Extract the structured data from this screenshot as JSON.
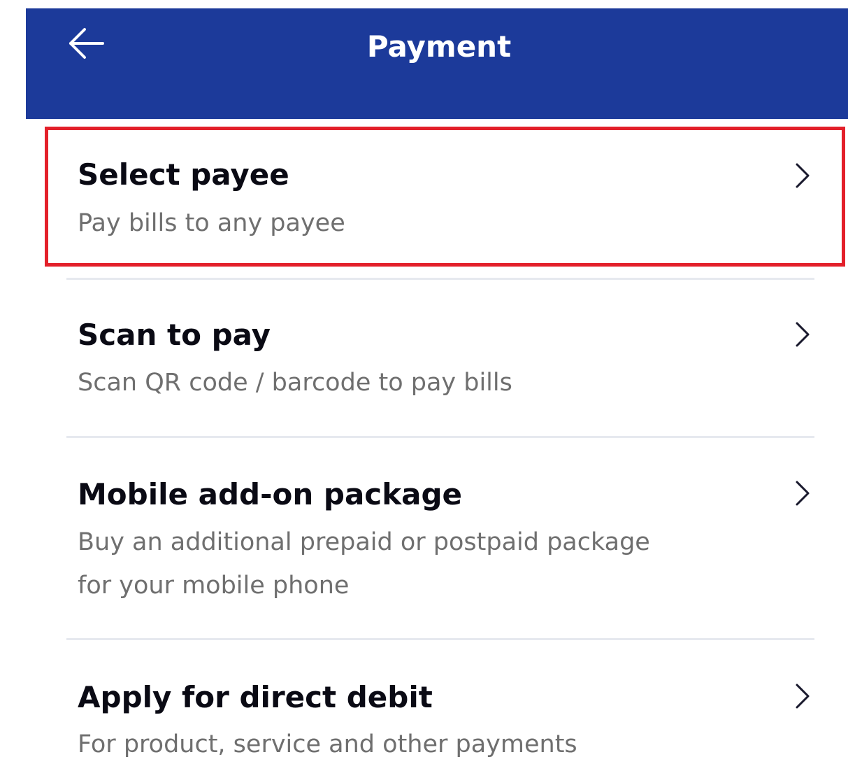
{
  "header": {
    "title": "Payment",
    "back_icon": "arrow-left-icon",
    "background_color": "#1c3a9a"
  },
  "menu": {
    "items": [
      {
        "title": "Select payee",
        "description": "Pay bills to any payee",
        "icon": "chevron-right-icon",
        "highlighted": true
      },
      {
        "title": "Scan to pay",
        "description": "Scan QR code / barcode to pay bills",
        "icon": "chevron-right-icon"
      },
      {
        "title": "Mobile add-on package",
        "description": "Buy an additional prepaid or postpaid package\nfor your mobile phone",
        "icon": "chevron-right-icon"
      },
      {
        "title": "Apply for direct debit",
        "description": "For product, service and other payments",
        "icon": "chevron-right-icon"
      }
    ]
  },
  "highlight_color": "#e3202a"
}
